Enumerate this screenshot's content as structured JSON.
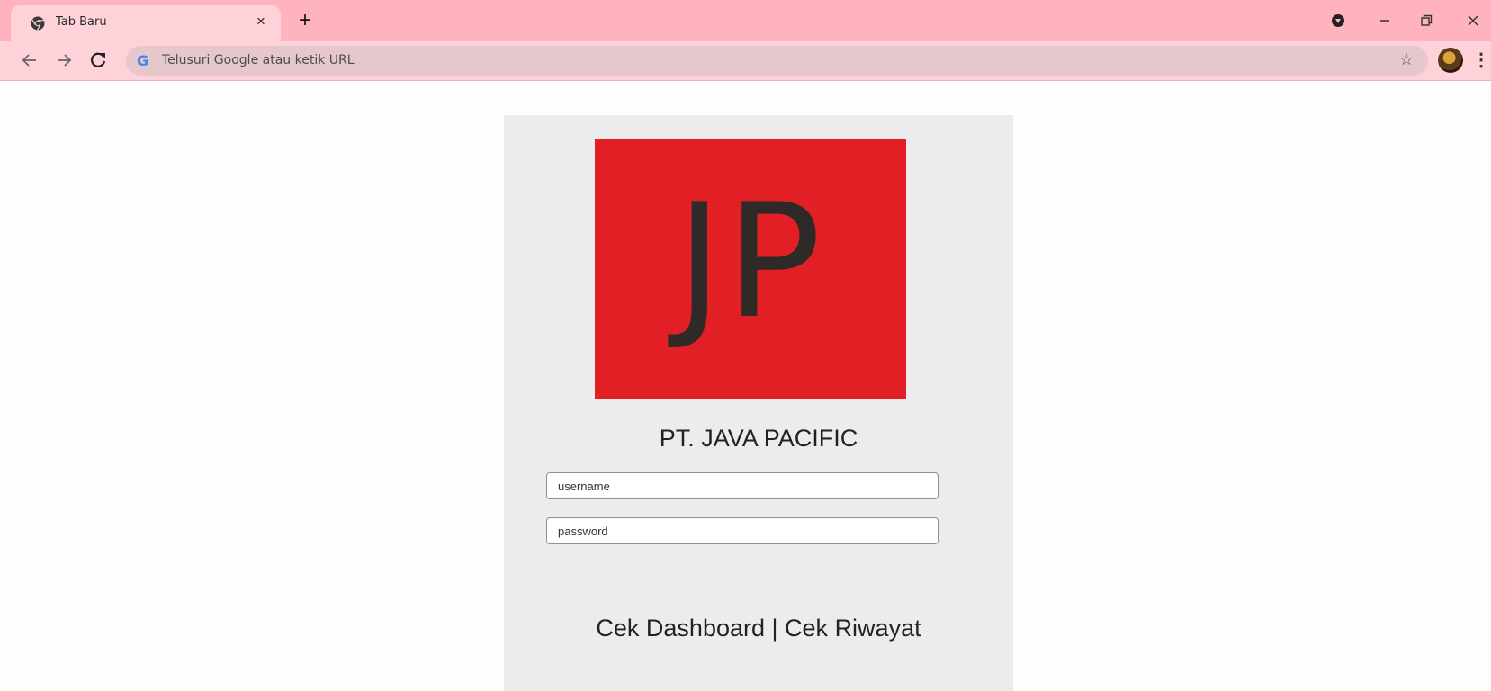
{
  "browser": {
    "tab_title": "Tab Baru",
    "tab_close": "×",
    "new_tab": "+",
    "omnibox_placeholder": "Telusuri Google atau ketik URL",
    "icons": {
      "favicon": "chrome-icon",
      "back": "arrow-left-icon",
      "forward": "arrow-right-icon",
      "reload": "reload-icon",
      "search_engine": "google-g-icon",
      "bookmark": "star-icon",
      "menu": "menu-dots-icon"
    },
    "chrome_color": "#ffb3bf"
  },
  "page": {
    "logo_text": "JP",
    "logo_color": "#e31f26",
    "company_name": "PT. JAVA PACIFIC",
    "username_placeholder": "username",
    "password_placeholder": "password",
    "link_dashboard": "Cek Dashboard",
    "link_separator": "|",
    "link_history": "Cek Riwayat"
  }
}
